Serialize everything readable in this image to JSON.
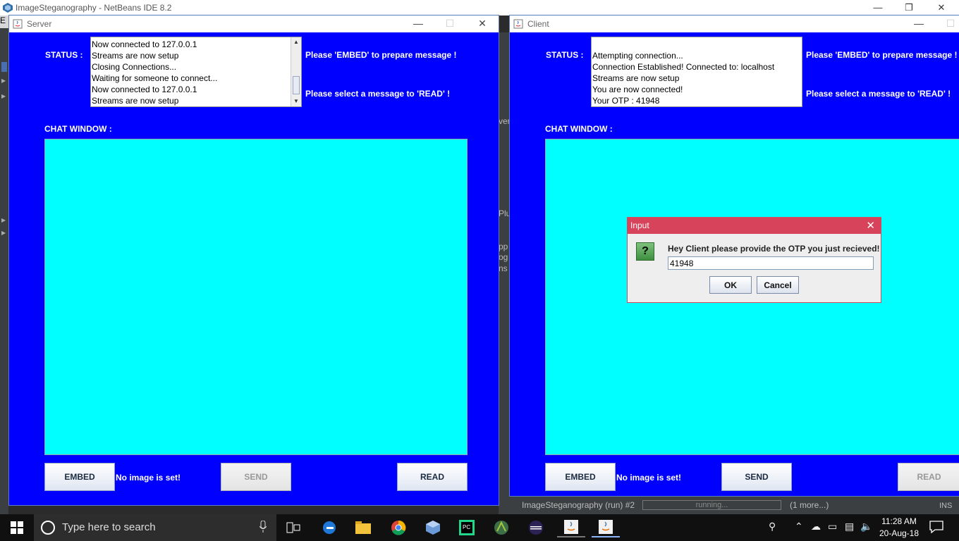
{
  "netbeans": {
    "title": "ImageSteganography - NetBeans IDE 8.2",
    "menu_fragment": "E",
    "mid_fragments": [
      "ver",
      "Plu",
      "pp",
      "og",
      "ns"
    ],
    "status_bar": {
      "task": "ImageSteganography (run) #2",
      "progress_text": "running...",
      "more": "(1 more...)",
      "mode": "INS"
    }
  },
  "server": {
    "title": "Server",
    "status_label": "STATUS :",
    "status_lines": [
      "Now connected to 127.0.0.1",
      "Streams are now setup",
      "Closing Connections...",
      "Waiting for someone to connect...",
      "Now connected to 127.0.0.1",
      "Streams are now setup"
    ],
    "embed_hint": "Please 'EMBED' to prepare message !",
    "read_hint": "Please select a message to 'READ' !",
    "chat_label": "CHAT WINDOW :",
    "buttons": {
      "embed": "EMBED",
      "send": "SEND",
      "read": "READ"
    },
    "image_status": "No image is set!"
  },
  "client": {
    "title": "Client",
    "status_label": "STATUS :",
    "status_lines": [
      "Attempting connection...",
      "Connection Established! Connected to: localhost",
      "Streams are now setup",
      " You are now connected!",
      " Your OTP : 41948"
    ],
    "embed_hint": "Please 'EMBED' to prepare message !",
    "read_hint": "Please select a message to 'READ' !",
    "chat_label": "CHAT WINDOW :",
    "buttons": {
      "embed": "EMBED",
      "send": "SEND",
      "read": "READ"
    },
    "image_status": "No image is set!"
  },
  "dialog": {
    "title": "Input",
    "message": "Hey Client please provide the OTP you just recieved!",
    "input_value": "41948",
    "ok": "OK",
    "cancel": "Cancel",
    "icon": "question-icon"
  },
  "taskbar": {
    "search_placeholder": "Type here to search",
    "time": "11:28 AM",
    "date": "20-Aug-18",
    "apps": [
      "task-view-icon",
      "edge-icon",
      "file-explorer-icon",
      "chrome-icon",
      "virtualbox-icon",
      "pycharm-icon",
      "android-studio-icon",
      "eclipse-icon",
      "java-icon",
      "java-icon"
    ]
  },
  "colors": {
    "window_bg": "#0000ff",
    "chat_bg": "#00ffff",
    "dialog_title": "#d8435c",
    "taskbar": "#101010"
  }
}
